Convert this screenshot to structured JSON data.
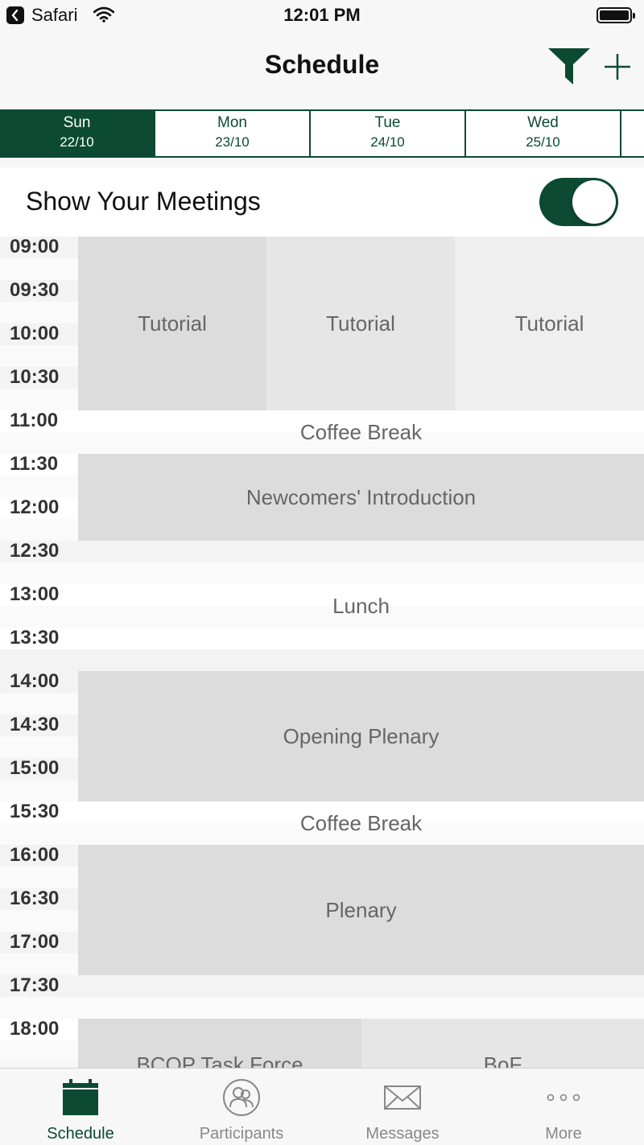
{
  "status_bar": {
    "back_app": "Safari",
    "time": "12:01 PM"
  },
  "nav": {
    "title": "Schedule",
    "filter_icon": "filter-icon",
    "add_icon": "plus-icon"
  },
  "days": [
    {
      "name": "Sun",
      "date": "22/10",
      "active": true
    },
    {
      "name": "Mon",
      "date": "23/10",
      "active": false
    },
    {
      "name": "Tue",
      "date": "24/10",
      "active": false
    },
    {
      "name": "Wed",
      "date": "25/10",
      "active": false
    }
  ],
  "meetings_toggle": {
    "label": "Show Your Meetings",
    "on": true
  },
  "times": [
    "09:00",
    "09:30",
    "10:00",
    "10:30",
    "11:00",
    "11:30",
    "12:00",
    "12:30",
    "13:00",
    "13:30",
    "14:00",
    "14:30",
    "15:00",
    "15:30",
    "16:00",
    "16:30",
    "17:00",
    "17:30",
    "18:00"
  ],
  "events": {
    "tutorial_1": "Tutorial",
    "tutorial_2": "Tutorial",
    "tutorial_3": "Tutorial",
    "coffee_break_1": "Coffee Break",
    "newcomers": "Newcomers' Introduction",
    "lunch": "Lunch",
    "opening_plenary": "Opening Plenary",
    "coffee_break_2": "Coffee Break",
    "plenary": "Plenary",
    "bcop": "BCOP Task Force",
    "bof": "BoF"
  },
  "tabbar": [
    {
      "label": "Schedule",
      "icon": "calendar-icon",
      "active": true
    },
    {
      "label": "Participants",
      "icon": "participants-icon",
      "active": false
    },
    {
      "label": "Messages",
      "icon": "envelope-icon",
      "active": false
    },
    {
      "label": "More",
      "icon": "more-icon",
      "active": false
    }
  ]
}
